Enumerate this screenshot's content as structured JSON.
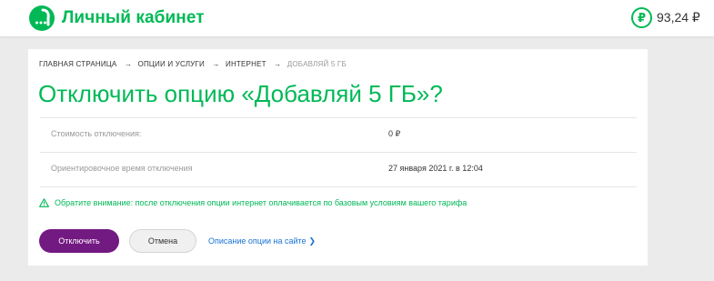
{
  "header": {
    "brand": "Личный кабинет",
    "balance_symbol": "₽",
    "balance": "93,24 ₽",
    "brand_color": "#00b956"
  },
  "breadcrumb": {
    "items": [
      "ГЛАВНАЯ СТРАНИЦА",
      "ОПЦИИ И УСЛУГИ",
      "ИНТЕРНЕТ"
    ],
    "separator": "→",
    "current": "ДОБАВЛЯЙ 5 ГБ"
  },
  "page": {
    "title": "Отключить опцию «Добавляй 5 ГБ»?"
  },
  "details": [
    {
      "label": "Стоимость отключения:",
      "value": "0 ₽"
    },
    {
      "label": "Ориентировочное время отключения",
      "value": "27 января 2021 г. в 12:04"
    }
  ],
  "notice": {
    "icon": "warning-icon",
    "text": "Обратите внимание: после отключения опции интернет оплачивается по базовым условиям вашего тарифа"
  },
  "actions": {
    "confirm_label": "Отключить",
    "cancel_label": "Отмена",
    "link_label": "Описание опции на сайте",
    "link_chevron": "❯",
    "primary_color": "#731982",
    "link_color": "#1a73d6"
  }
}
